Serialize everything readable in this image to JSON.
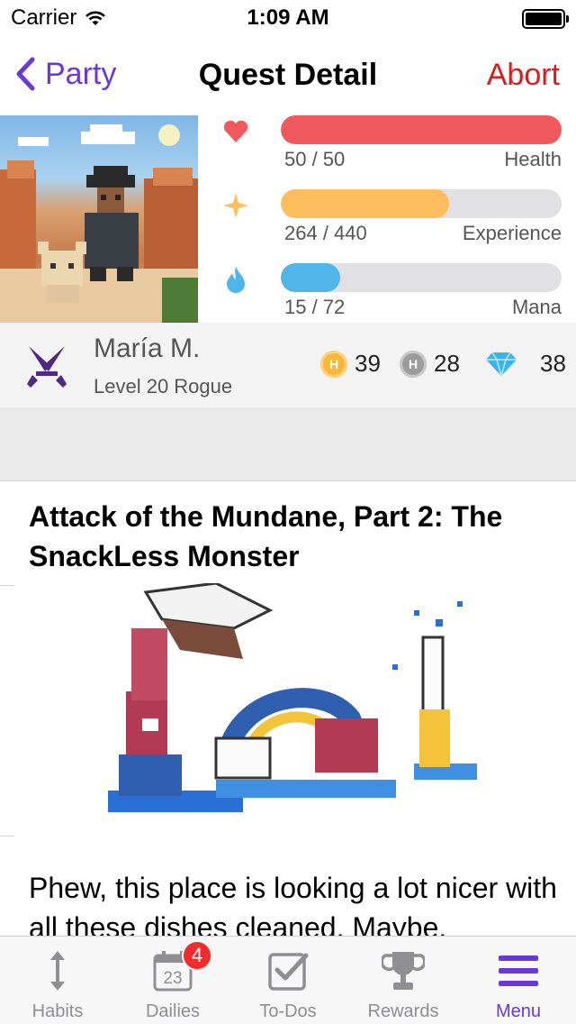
{
  "status_bar": {
    "carrier": "Carrier",
    "time": "1:09 AM"
  },
  "nav": {
    "back_label": "Party",
    "title": "Quest Detail",
    "action_label": "Abort"
  },
  "stats": [
    {
      "icon": "heart-icon",
      "value": "50 / 50",
      "label": "Health",
      "fill": 1.0,
      "color": "#f05a5f"
    },
    {
      "icon": "star-icon",
      "value": "264 / 440",
      "label": "Experience",
      "fill": 0.6,
      "color": "#ffbe5d"
    },
    {
      "icon": "flame-icon",
      "value": "15 / 72",
      "label": "Mana",
      "fill": 0.21,
      "color": "#50b5e9"
    }
  ],
  "profile": {
    "name": "María M.",
    "level": "Level 20 Rogue",
    "gold": "39",
    "silver": "28",
    "gems": "38"
  },
  "quest": {
    "title": "Attack of the Mundane, Part 2: The SnackLess Monster",
    "body": "Phew, this place is looking a lot nicer with all these dishes cleaned. Maybe,"
  },
  "tabs": [
    {
      "label": "Habits",
      "icon": "habits-icon"
    },
    {
      "label": "Dailies",
      "icon": "calendar-icon",
      "badge": "4",
      "calendar_day": "23"
    },
    {
      "label": "To-Dos",
      "icon": "checkbox-icon"
    },
    {
      "label": "Rewards",
      "icon": "trophy-icon"
    },
    {
      "label": "Menu",
      "icon": "menu-icon",
      "active": true
    }
  ],
  "colors": {
    "accent": "#6a38d6",
    "abort": "#d61e1e",
    "gold": "#f9b83a",
    "silver": "#9b9b9b",
    "gem": "#3bb5e9"
  }
}
